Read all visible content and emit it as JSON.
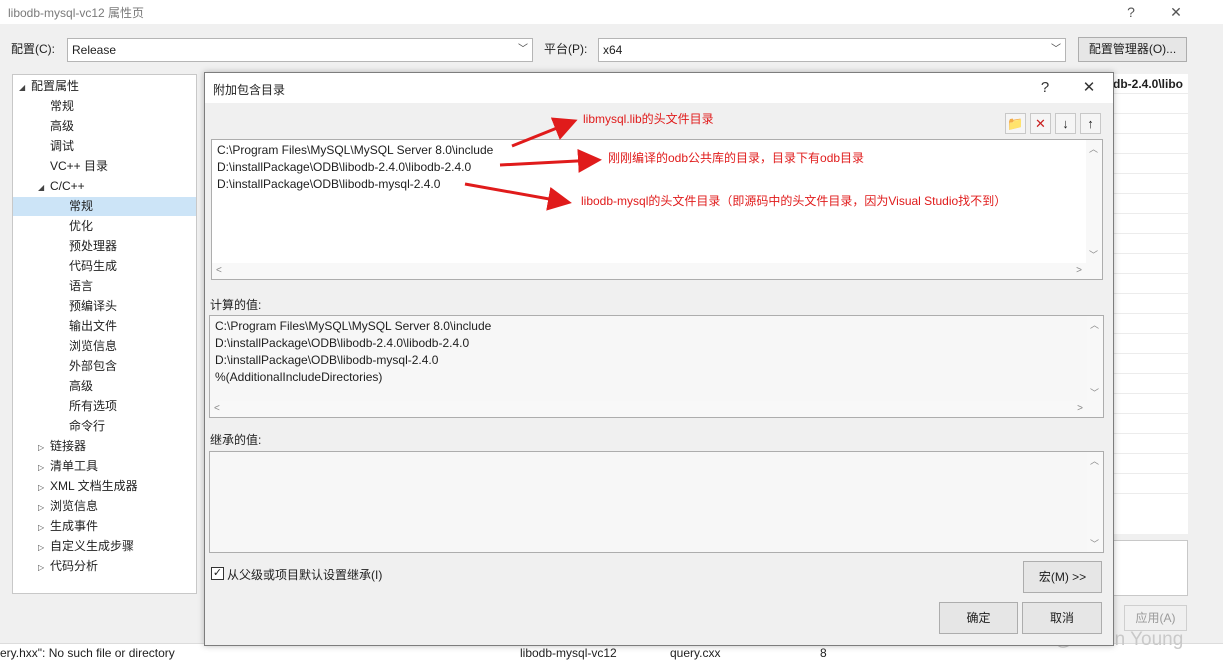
{
  "window": {
    "title": "libodb-mysql-vc12 属性页",
    "help": "?",
    "close": "✕"
  },
  "config_bar": {
    "config_label": "配置(C):",
    "config_value": "Release",
    "platform_label": "平台(P):",
    "platform_value": "x64",
    "manager_button": "配置管理器(O)..."
  },
  "tree": {
    "items": [
      {
        "label": "配置属性",
        "glyph": "◢"
      },
      {
        "label": "常规"
      },
      {
        "label": "高级"
      },
      {
        "label": "调试"
      },
      {
        "label": "VC++ 目录"
      },
      {
        "label": "C/C++",
        "glyph": "◢"
      },
      {
        "label": "常规"
      },
      {
        "label": "优化"
      },
      {
        "label": "预处理器"
      },
      {
        "label": "代码生成"
      },
      {
        "label": "语言"
      },
      {
        "label": "预编译头"
      },
      {
        "label": "输出文件"
      },
      {
        "label": "浏览信息"
      },
      {
        "label": "外部包含"
      },
      {
        "label": "高级"
      },
      {
        "label": "所有选项"
      },
      {
        "label": "命令行"
      },
      {
        "label": "链接器",
        "glyph": "▷"
      },
      {
        "label": "清单工具",
        "glyph": "▷"
      },
      {
        "label": "XML 文档生成器",
        "glyph": "▷"
      },
      {
        "label": "浏览信息",
        "glyph": "▷"
      },
      {
        "label": "生成事件",
        "glyph": "▷"
      },
      {
        "label": "自定义生成步骤",
        "glyph": "▷"
      },
      {
        "label": "代码分析",
        "glyph": "▷"
      }
    ]
  },
  "right_grid": {
    "first_value": "db-2.4.0\\libo"
  },
  "apply_button": "应用(A)",
  "status": {
    "message": "ery.hxx\": No such file or directory",
    "project": "libodb-mysql-vc12",
    "file": "query.cxx",
    "line": "8"
  },
  "watermark": "CSDN @Lution Young",
  "dialog": {
    "title": "附加包含目录",
    "help": "?",
    "close": "✕",
    "toolbar": {
      "new_folder": "📁",
      "delete": "✕",
      "move_down": "↓",
      "move_up": "↑"
    },
    "entries": [
      "C:\\Program Files\\MySQL\\MySQL Server 8.0\\include",
      "D:\\installPackage\\ODB\\libodb-2.4.0\\libodb-2.4.0",
      "D:\\installPackage\\ODB\\libodb-mysql-2.4.0"
    ],
    "computed_label": "计算的值:",
    "computed": [
      "C:\\Program Files\\MySQL\\MySQL Server 8.0\\include",
      "D:\\installPackage\\ODB\\libodb-2.4.0\\libodb-2.4.0",
      "D:\\installPackage\\ODB\\libodb-mysql-2.4.0",
      "%(AdditionalIncludeDirectories)"
    ],
    "inherited_label": "继承的值:",
    "inherit_checkbox": "从父级或项目默认设置继承(I)",
    "inherit_checked": "✓",
    "macros_button": "宏(M) >>",
    "ok_button": "确定",
    "cancel_button": "取消"
  },
  "annotations": [
    "libmysql.lib的头文件目录",
    "刚刚编译的odb公共库的目录，目录下有odb目录",
    "libodb-mysql的头文件目录（即源码中的头文件目录，因为Visual Studio找不到）"
  ],
  "colors": {
    "annotation": "#e01b1b",
    "selection": "#cce4f7"
  }
}
